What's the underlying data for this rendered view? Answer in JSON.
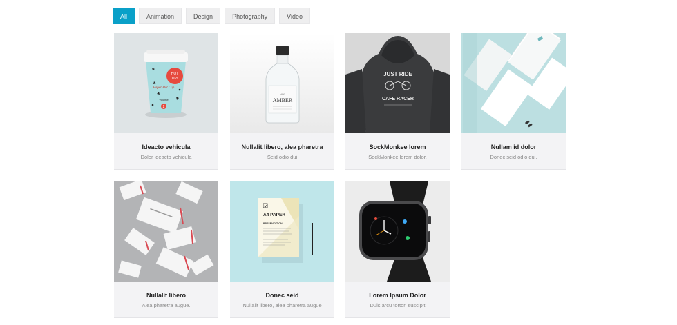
{
  "filters": [
    {
      "label": "All",
      "active": true
    },
    {
      "label": "Animation",
      "active": false
    },
    {
      "label": "Design",
      "active": false
    },
    {
      "label": "Photography",
      "active": false
    },
    {
      "label": "Video",
      "active": false
    }
  ],
  "cards": [
    {
      "title": "Ideacto vehicula",
      "subtitle": "Dolor ideacto vehicula",
      "image": "paper-cup"
    },
    {
      "title": "Nullalit libero, alea pharetra",
      "subtitle": "Seid odio dui",
      "image": "glass-bottle"
    },
    {
      "title": "SockMonkee lorem",
      "subtitle": "SockMonkee lorem dolor.",
      "image": "hoodie"
    },
    {
      "title": "Nullam id dolor",
      "subtitle": "Donec seid odio dui.",
      "image": "business-cards-stack"
    },
    {
      "title": "Nullalit libero",
      "subtitle": "Alea pharetra augue.",
      "image": "flying-business-cards"
    },
    {
      "title": "Donec seid",
      "subtitle": "Nullalit libero, alea pharetra augue",
      "image": "a4-paper"
    },
    {
      "title": "Lorem Ipsum Dolor",
      "subtitle": "Duis arcu tortor, suscipit",
      "image": "smartwatch"
    }
  ],
  "image_text": {
    "cup_line1": "HOT",
    "cup_line2": "UP!",
    "cup_brand": "Paper Hot Cup",
    "cup_vol": "Volume",
    "cup_num": "2",
    "bottle_label": "AMBER",
    "bottle_no": "NO1",
    "hoodie_top": "JUST RIDE",
    "hoodie_bottom": "CAFE RACER",
    "paper_title": "A4 PAPER",
    "paper_sub": "PRESENTATION"
  }
}
